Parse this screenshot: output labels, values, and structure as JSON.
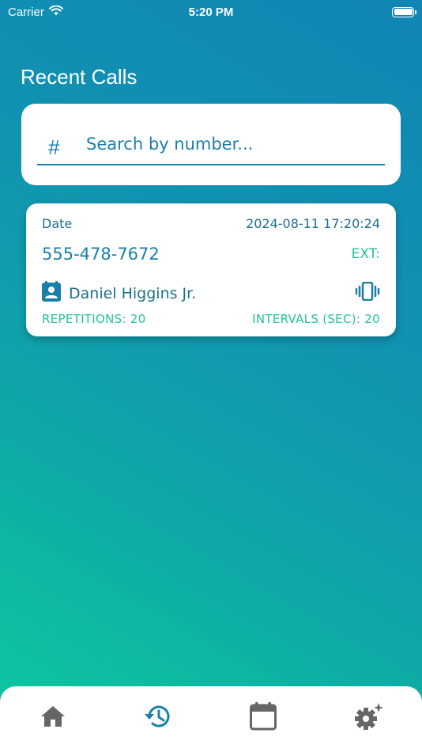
{
  "status_bar": {
    "carrier": "Carrier",
    "time": "5:20 PM",
    "icons": [
      "wifi-icon",
      "battery-icon"
    ]
  },
  "page": {
    "title": "Recent Calls"
  },
  "search": {
    "icon": "hash-icon",
    "placeholder": "Search by number...",
    "value": ""
  },
  "calls": [
    {
      "date_label": "Date",
      "datetime": "2024-08-11 17:20:24",
      "number": "555-478-7672",
      "ext_label": "EXT:",
      "contact_name": "Daniel Higgins Jr.",
      "repetitions": "REPETITIONS: 20",
      "intervals": "INTERVALS (SEC): 20"
    }
  ],
  "tabs": [
    {
      "name": "home",
      "icon": "home-icon",
      "active": false
    },
    {
      "name": "history",
      "icon": "history-icon",
      "active": true
    },
    {
      "name": "calendar",
      "icon": "calendar-icon",
      "active": false
    },
    {
      "name": "settings",
      "icon": "settings-icon",
      "active": false
    }
  ],
  "colors": {
    "accent": "#1a7fa8",
    "green": "#22c39a",
    "inactive_tab": "#666666"
  }
}
